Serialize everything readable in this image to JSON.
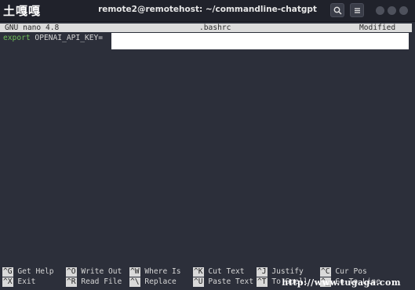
{
  "watermark_top": "土嘎嘎",
  "window": {
    "title": "remote2@remotehost: ~/commandline-chatgpt"
  },
  "nano": {
    "version": "GNU nano 4.8",
    "filename": ".bashrc",
    "status": "Modified"
  },
  "editor": {
    "keyword": "export",
    "line_rest": " OPENAI_API_KEY="
  },
  "shortcuts": [
    {
      "key": "^G",
      "label": "Get Help"
    },
    {
      "key": "^O",
      "label": "Write Out"
    },
    {
      "key": "^W",
      "label": "Where Is"
    },
    {
      "key": "^K",
      "label": "Cut Text"
    },
    {
      "key": "^J",
      "label": "Justify"
    },
    {
      "key": "^C",
      "label": "Cur Pos"
    },
    {
      "key": "^X",
      "label": "Exit"
    },
    {
      "key": "^R",
      "label": "Read File"
    },
    {
      "key": "^\\",
      "label": "Replace"
    },
    {
      "key": "^U",
      "label": "Paste Text"
    },
    {
      "key": "^T",
      "label": "To Spell"
    },
    {
      "key": "^_",
      "label": "Go To Line"
    }
  ],
  "watermark_bottom": "http://www.tugaga.com",
  "icons": {
    "search": "search-icon",
    "menu": "hamburger-menu-icon"
  }
}
